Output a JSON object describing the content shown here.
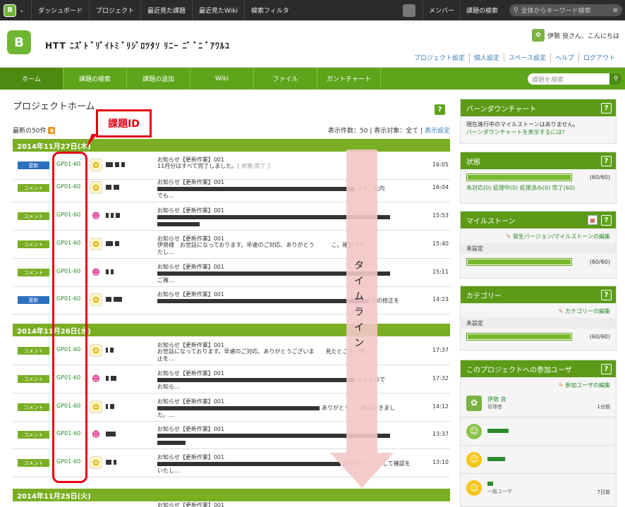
{
  "topbar": {
    "brand_letter": "B",
    "nav": [
      "ダッシュボード",
      "プロジェクト",
      "最近見た課題",
      "最近見たWiki",
      "検索フィルタ"
    ],
    "right": [
      "メンバー",
      "課題の検索"
    ],
    "search_placeholder": "全体からキーワード検索"
  },
  "header": {
    "project_title": "HTT ﾆｽﾞﾄ ﾞﾘﾞｲﾄﾐ ﾞﾘｼﾞﾛﾂﾀｿ ﾘﾆｰ ﾆﾞ ﾞﾆ ﾞｱﾜﾙﾕ",
    "greeting": "伊勢 良さん、こんにちは",
    "links": [
      "プロジェクト設定",
      "個人設定",
      "スペース設定",
      "ヘルプ",
      "ログアウト"
    ]
  },
  "greennav": {
    "tabs": [
      "ホーム",
      "課題の検索",
      "課題の追加",
      "Wiki",
      "ファイル",
      "ガントチャート"
    ],
    "search_placeholder": "課題を検索"
  },
  "main": {
    "title": "プロジェクトホーム",
    "recent": "最新の50件",
    "display_count": "表示件数：50 | 表示対象：全て | ",
    "display_setting": "表示設定",
    "dates": [
      "2014年11月27日(木)",
      "2014年11月26日(水)",
      "2014年11月25日(火)"
    ],
    "rows": [
      {
        "badge": "更新",
        "issue": "GP01-60",
        "title": "お知らせ【更新作業】001",
        "body": "11月分はすべて完了しました。",
        "extra": "[ 状態:完了 ]",
        "time": "16:05"
      },
      {
        "badge": "コメント",
        "issue": "GP01-60",
        "title": "お知らせ【更新作業】001",
        "body": "ます。社内",
        "extra": "でも…",
        "time": "16:04"
      },
      {
        "badge": "コメント",
        "issue": "GP01-60",
        "title": "お知らせ【更新作業】001",
        "body": "",
        "extra": "",
        "time": "15:53"
      },
      {
        "badge": "コメント",
        "issue": "GP01-60",
        "title": "お知らせ【更新作業】001",
        "body": "伊勢様　お世話になっております。早速のご対応、ありがとう　　　こ。確認させ",
        "extra": "たし…",
        "time": "15:40"
      },
      {
        "badge": "コメント",
        "issue": "GP01-60",
        "title": "お知らせ【更新作業】001",
        "body": "",
        "extra": "ご確…",
        "time": "15:11"
      },
      {
        "badge": "更新",
        "issue": "GP01-60",
        "title": "お知らせ【更新作業】001",
        "body": "所の修正を",
        "extra": "",
        "time": "14:23"
      },
      {
        "badge": "コメント",
        "issue": "GP01-60",
        "title": "お知らせ【更新作業】001",
        "body": "お世話になっております。早速のご対応、ありがとうございま　　見たところ、修",
        "extra": "止を…",
        "time": "17:37"
      },
      {
        "badge": "コメント",
        "issue": "GP01-60",
        "title": "お知らせ【更新作業】001",
        "body": "ましたので",
        "extra": "お知ら…",
        "time": "17:32"
      },
      {
        "badge": "コメント",
        "issue": "GP01-60",
        "title": "お知らせ【更新作業】001",
        "body": "ありがとう　　確認できまし",
        "extra": "た。…",
        "time": "14:12"
      },
      {
        "badge": "コメント",
        "issue": "GP01-60",
        "title": "お知らせ【更新作業】001",
        "body": "",
        "extra": "",
        "time": "13:37"
      },
      {
        "badge": "コメント",
        "issue": "GP01-60",
        "title": "お知らせ【更新作業】001",
        "body": "ありがとう　　して確認を",
        "extra": "いたし…",
        "time": "13:10"
      },
      {
        "badge": "",
        "issue": "",
        "title": "お知らせ【更新作業】001",
        "body": "",
        "extra": "",
        "time": ""
      }
    ]
  },
  "annotation": {
    "label": "課題ID",
    "timeline": [
      "タ",
      "イ",
      "ム",
      "ラ",
      "イ",
      "ン"
    ]
  },
  "sidebar": {
    "burndown": {
      "title": "バーンダウンチャート",
      "text1": "現在進行中のマイルストーンはありません。",
      "text2": "バーンダウンチャートを表示するには?"
    },
    "status": {
      "title": "状態",
      "count": "(60/60)",
      "progress": 1.0,
      "legend": "未対応(0) 処理中(0) 処理済み(0) 完了(60)"
    },
    "milestone": {
      "title": "マイルストーン",
      "edit": "発生バージョン/マイルストーンの編集",
      "unset": "未設定",
      "count": "(60/60)",
      "progress": 1.0
    },
    "category": {
      "title": "カテゴリー",
      "edit": "カテゴリーの編集",
      "unset": "未設定",
      "count": "(60/60)",
      "progress": 1.0
    },
    "members": {
      "title": "このプロジェクトへの参加ユーザ",
      "edit": "参加ユーザの編集",
      "list": [
        {
          "name": "伊勢 良",
          "role": "管理者",
          "time": "1分前"
        },
        {
          "name": "",
          "role": "",
          "time": ""
        },
        {
          "name": "",
          "role": "",
          "time": ""
        },
        {
          "name": "",
          "role": "一般ユーザ",
          "time": "7日前"
        }
      ]
    },
    "help": "?"
  },
  "colors": {
    "green": "#5ea51b",
    "annotation_red": "#e60012",
    "timeline_pink": "#f4c7c7",
    "update_blue": "#2d6fc0"
  }
}
